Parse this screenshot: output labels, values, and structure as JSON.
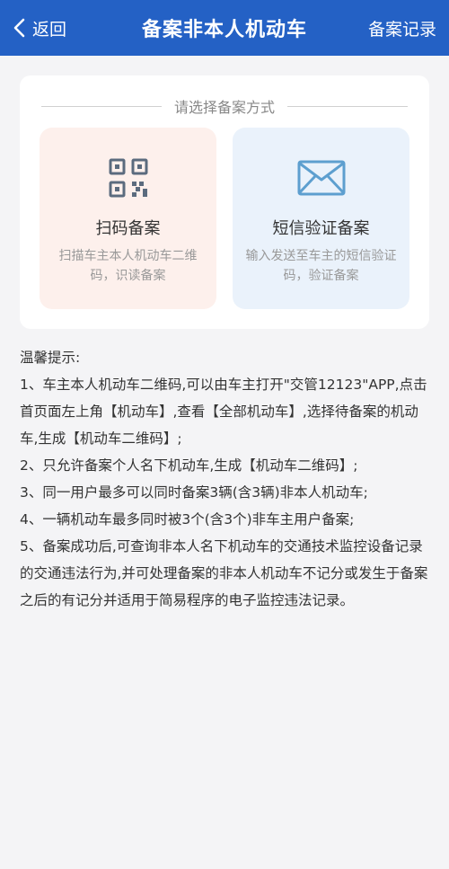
{
  "navbar": {
    "back_label": "返回",
    "title": "备案非本人机动车",
    "action_label": "备案记录",
    "background": "#2461c5"
  },
  "card": {
    "prompt": "请选择备案方式",
    "options": [
      {
        "title": "扫码备案",
        "desc": "扫描车主本人机动车二维码，识读备案",
        "icon": "qrcode-icon"
      },
      {
        "title": "短信验证备案",
        "desc": "输入发送至车主的短信验证码，验证备案",
        "icon": "envelope-icon"
      }
    ]
  },
  "tips": {
    "heading": "温馨提示:",
    "items": [
      "1、车主本人机动车二维码,可以由车主打开\"交管12123\"APP,点击首页面左上角【机动车】,查看【全部机动车】,选择待备案的机动车,生成【机动车二维码】;",
      "2、只允许备案个人名下机动车,生成【机动车二维码】;",
      "3、同一用户最多可以同时备案3辆(含3辆)非本人机动车;",
      "4、一辆机动车最多同时被3个(含3个)非车主用户备案;",
      "5、备案成功后,可查询非本人名下机动车的交通技术监控设备记录的交通违法行为,并可处理备案的非本人机动车不记分或发生于备案之后的有记分并适用于简易程序的电子监控违法记录。"
    ]
  }
}
